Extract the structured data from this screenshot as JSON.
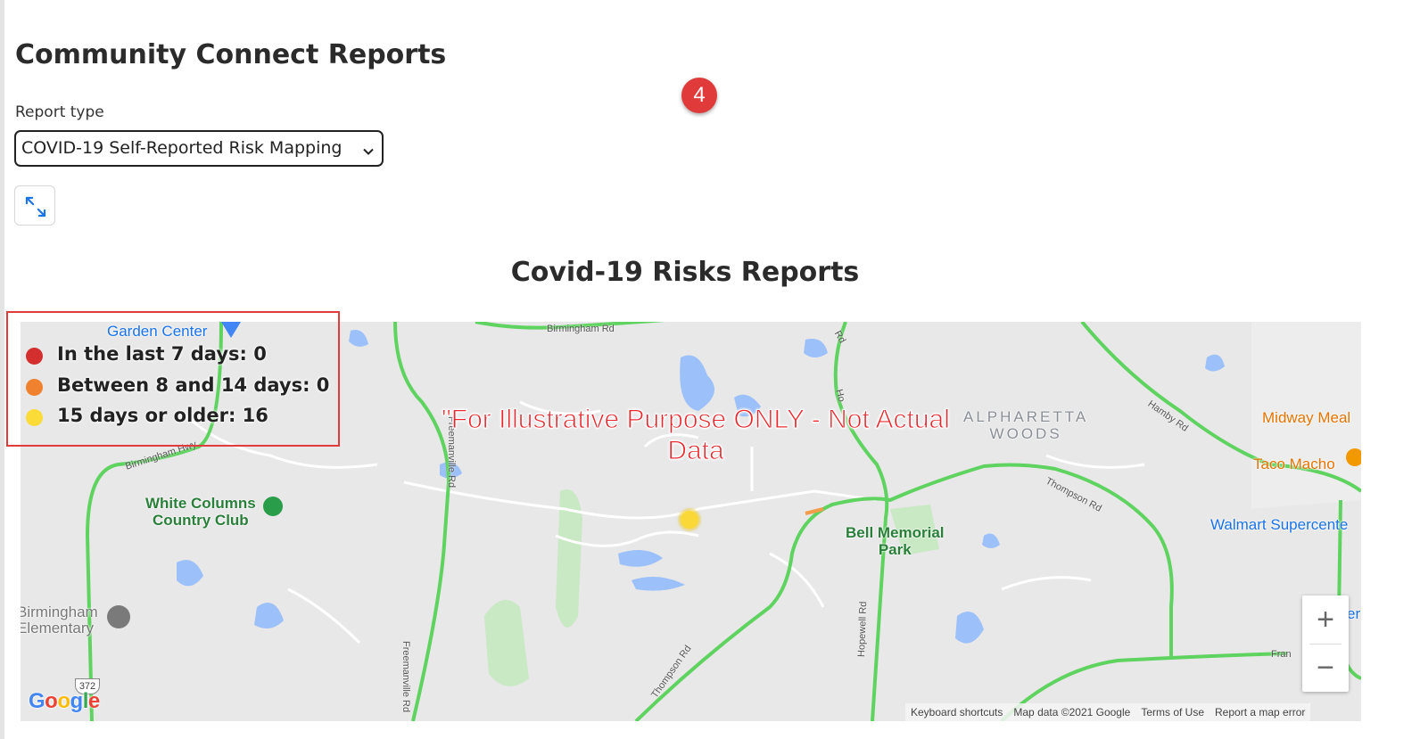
{
  "page": {
    "title": "Community Connect Reports",
    "step_badge": "4"
  },
  "report_type": {
    "label": "Report type",
    "selected": "COVID-19 Self-Reported Risk Mapping"
  },
  "map_section": {
    "title": "Covid-19 Risks Reports",
    "disclaimer_line1": "\"For Illustrative Purpose ONLY - Not Actual",
    "disclaimer_line2": "Data"
  },
  "legend": {
    "items": [
      {
        "label": "In the last 7 days: 0",
        "color": "#d32f2f"
      },
      {
        "label": "Between 8 and 14 days: 0",
        "color": "#f0812e"
      },
      {
        "label": "15 days or older: 16",
        "color": "#fbdb37"
      }
    ]
  },
  "map": {
    "places": {
      "garden_center": "Garden Center",
      "white_columns_1": "White Columns",
      "white_columns_2": "Country Club",
      "bell_memorial_1": "Bell Memorial",
      "bell_memorial_2": "Park",
      "alpharetta_1": "ALPHARETTA",
      "alpharetta_2": "WOODS",
      "midway_meal": "Midway Meal",
      "taco_macho": "Taco Macho",
      "walmart": "Walmart Supercente",
      "birmingham_1": "Birmingham",
      "birmingham_2": "Elementary",
      "edge_partial": "er"
    },
    "roads": {
      "birmingham_rd": "Birmingham Rd",
      "birmingham_hwy": "Birmingham Hwy",
      "freemanville_rd": "Freemanville Rd",
      "thompson_rd": "Thompson Rd",
      "hopewell_rd": "Hopewell Rd",
      "hamby_rd": "Hamby Rd",
      "route_372": "372",
      "fran": "Fran",
      "ho": "Ho",
      "rd": "Rd"
    },
    "google": "Google",
    "zoom_in": "+",
    "zoom_out": "−",
    "attribution": {
      "keyboard": "Keyboard shortcuts",
      "map_data": "Map data ©2021 Google",
      "terms": "Terms of Use",
      "report": "Report a map error"
    },
    "colors": {
      "road": "#5fd35f",
      "water": "#9cc0f9",
      "park": "#c9e8c4",
      "point": "#f9d837"
    }
  }
}
